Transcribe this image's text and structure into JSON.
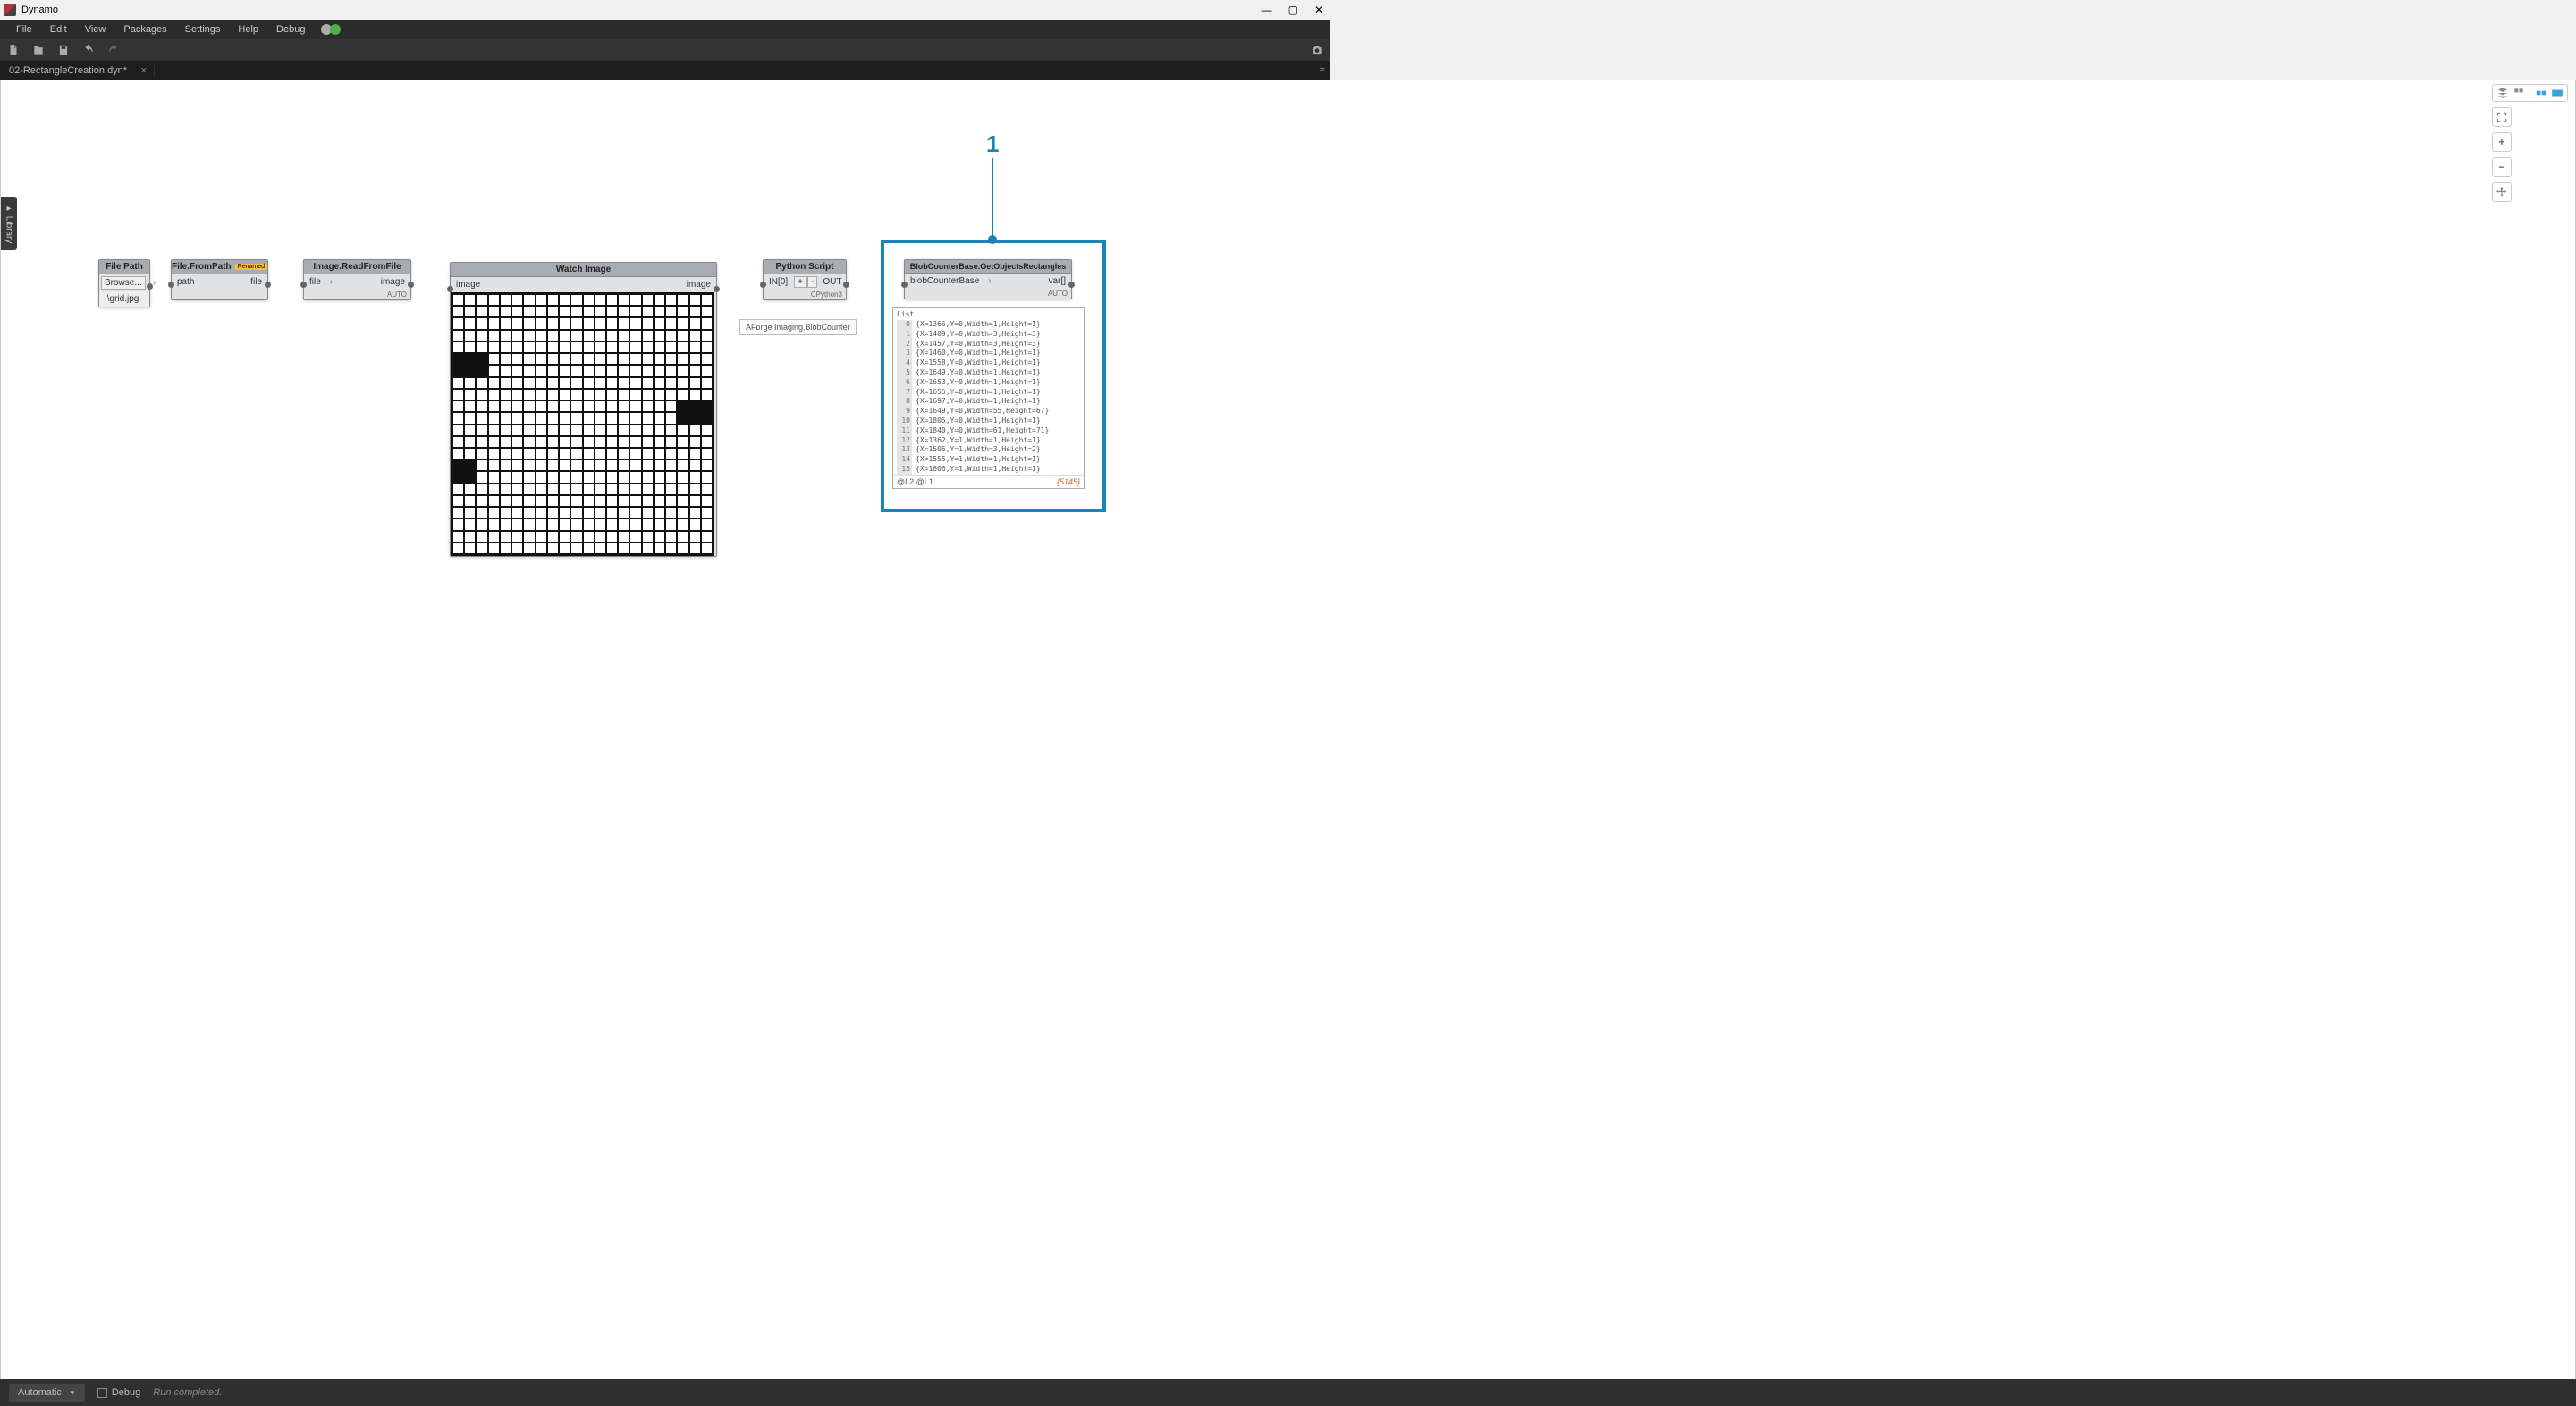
{
  "app": {
    "title": "Dynamo"
  },
  "menu": [
    "File",
    "Edit",
    "View",
    "Packages",
    "Settings",
    "Help",
    "Debug"
  ],
  "tab": {
    "name": "02-RectangleCreation.dyn*"
  },
  "runmode": "Automatic",
  "debug_label": "Debug",
  "run_status": "Run completed.",
  "library_label": "Library",
  "callout_number": "1",
  "nodes": {
    "filepath": {
      "title": "File Path",
      "button": "Browse...",
      "value": ".\\grid.jpg"
    },
    "filefrompath": {
      "title": "File.FromPath",
      "badge": "Renamed",
      "in": "path",
      "out": "file"
    },
    "imageread": {
      "title": "Image.ReadFromFile",
      "in": "file",
      "out": "image",
      "foot": "AUTO"
    },
    "watch": {
      "title": "Watch Image",
      "in": "image",
      "out": "image"
    },
    "python": {
      "title": "Python Script",
      "in": "IN[0]",
      "plus": "+",
      "minus": "-",
      "out": "OUT",
      "foot": "CPython3"
    },
    "python_tooltip": "AForge.Imaging.BlobCounter",
    "blob": {
      "title": "BlobCounterBase.GetObjectsRectangles",
      "in": "blobCounterBase",
      "out": "var[]",
      "foot": "AUTO",
      "list_label": "List",
      "levels": "@L2 @L1",
      "count": "{5145}",
      "rows": [
        {
          "i": "0",
          "v": "{X=1366,Y=0,Width=1,Height=1}"
        },
        {
          "i": "1",
          "v": "{X=1409,Y=0,Width=3,Height=3}"
        },
        {
          "i": "2",
          "v": "{X=1457,Y=0,Width=3,Height=3}"
        },
        {
          "i": "3",
          "v": "{X=1460,Y=0,Width=1,Height=1}"
        },
        {
          "i": "4",
          "v": "{X=1558,Y=0,Width=1,Height=1}"
        },
        {
          "i": "5",
          "v": "{X=1649,Y=0,Width=1,Height=1}"
        },
        {
          "i": "6",
          "v": "{X=1653,Y=0,Width=1,Height=1}"
        },
        {
          "i": "7",
          "v": "{X=1655,Y=0,Width=1,Height=1}"
        },
        {
          "i": "8",
          "v": "{X=1697,Y=0,Width=1,Height=1}"
        },
        {
          "i": "9",
          "v": "{X=1649,Y=0,Width=55,Height=67}"
        },
        {
          "i": "10",
          "v": "{X=1805,Y=0,Width=1,Height=1}"
        },
        {
          "i": "11",
          "v": "{X=1840,Y=0,Width=61,Height=71}"
        },
        {
          "i": "12",
          "v": "{X=1362,Y=1,Width=1,Height=1}"
        },
        {
          "i": "13",
          "v": "{X=1506,Y=1,Width=3,Height=2}"
        },
        {
          "i": "14",
          "v": "{X=1555,Y=1,Width=1,Height=1}"
        },
        {
          "i": "15",
          "v": "{X=1606,Y=1,Width=1,Height=1}"
        }
      ]
    }
  }
}
